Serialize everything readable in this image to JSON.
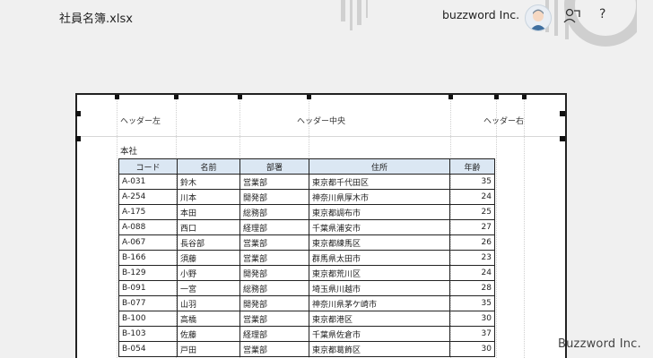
{
  "titlebar": {
    "filename": "社員名簿.xlsx",
    "account_name": "buzzword Inc.",
    "help_label": "?",
    "icons": [
      "avatar",
      "share-icon",
      "help-icon"
    ]
  },
  "page_header": {
    "left": "ヘッダー左",
    "center": "ヘッダー中央",
    "right": "ヘッダー右"
  },
  "sheet": {
    "title": "本社",
    "columns": [
      "コード",
      "名前",
      "部署",
      "住所",
      "年齢"
    ],
    "rows": [
      [
        "A-031",
        "鈴木",
        "営業部",
        "東京都千代田区",
        "35"
      ],
      [
        "A-254",
        "川本",
        "開発部",
        "神奈川県厚木市",
        "24"
      ],
      [
        "A-175",
        "本田",
        "総務部",
        "東京都調布市",
        "25"
      ],
      [
        "A-088",
        "西口",
        "経理部",
        "千葉県浦安市",
        "27"
      ],
      [
        "A-067",
        "長谷部",
        "営業部",
        "東京都練馬区",
        "26"
      ],
      [
        "B-166",
        "須藤",
        "営業部",
        "群馬県太田市",
        "23"
      ],
      [
        "B-129",
        "小野",
        "開発部",
        "東京都荒川区",
        "24"
      ],
      [
        "B-091",
        "一宮",
        "総務部",
        "埼玉県川越市",
        "28"
      ],
      [
        "B-077",
        "山羽",
        "開発部",
        "神奈川県茅ケ崎市",
        "35"
      ],
      [
        "B-100",
        "高橋",
        "営業部",
        "東京都港区",
        "30"
      ],
      [
        "B-103",
        "佐藤",
        "経理部",
        "千葉県佐倉市",
        "37"
      ],
      [
        "B-054",
        "戸田",
        "営業部",
        "東京都葛飾区",
        "30"
      ]
    ]
  },
  "watermark": "Buzzword Inc.",
  "colors": {
    "background": "#f0f0f0",
    "header_fill": "#dbe7f3",
    "border": "#222222"
  }
}
